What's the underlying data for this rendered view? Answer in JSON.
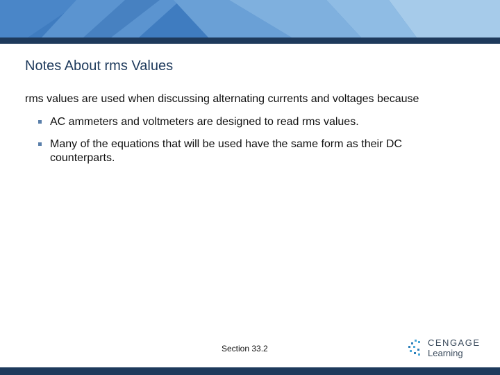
{
  "slide": {
    "title": "Notes About rms Values",
    "intro": "rms values are used when discussing alternating currents and voltages because",
    "bullets": [
      "AC ammeters and voltmeters are designed to read rms values.",
      "Many of the equations that will be used have the same form as their DC counterparts."
    ],
    "footer": "Section  33.2"
  },
  "logo": {
    "brand": "CENGAGE",
    "sub": "Learning"
  },
  "colors": {
    "header_band": "#3f7cc0",
    "header_rule": "#1e3a5c",
    "title_text": "#1e3a5c",
    "bullet_marker": "#5a7faa",
    "logo_mark": "#4aa8d8"
  }
}
